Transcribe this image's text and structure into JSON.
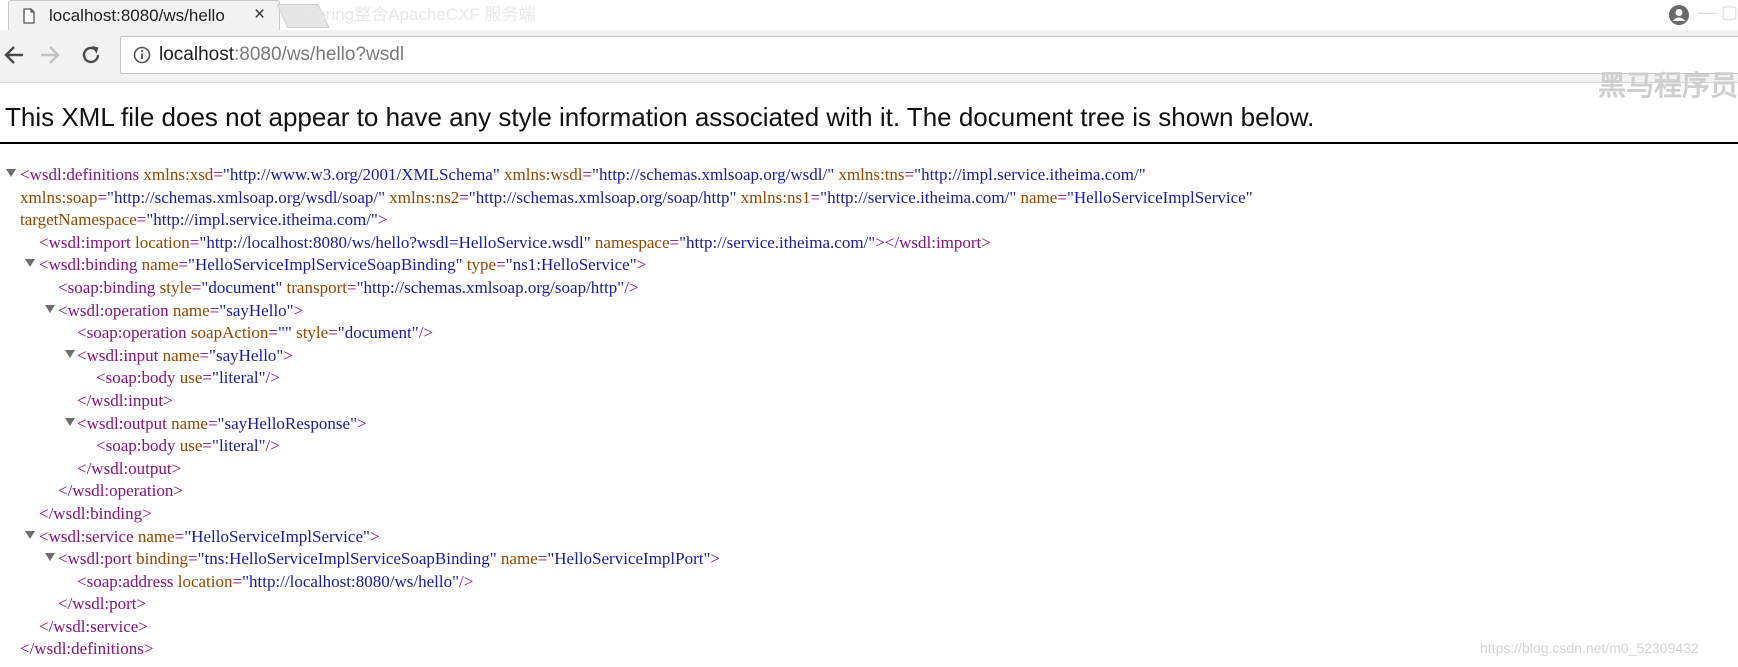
{
  "browser": {
    "tab_title": "localhost:8080/ws/hello",
    "tab_close": "×",
    "overlay_title": "Spring整合ApacheCXF 服务端",
    "url_host": "localhost",
    "url_rest": ":8080/ws/hello?wsdl",
    "brand_watermark": "黑马程序员",
    "icons": [
      "document-icon",
      "close-icon",
      "account-icon",
      "back-icon",
      "forward-icon",
      "reload-icon",
      "info-icon"
    ]
  },
  "page": {
    "notice": "This XML file does not appear to have any style information associated with it. The document tree is shown below.",
    "footer_watermark": "https://blog.csdn.net/m0_52309432"
  },
  "tree": {
    "lines": [
      {
        "lead": "<wsdl:definitions",
        "attrs": [
          [
            "xmlns:xsd",
            "http://www.w3.org/2001/XMLSchema"
          ],
          [
            "xmlns:wsdl",
            "http://schemas.xmlsoap.org/wsdl/"
          ],
          [
            "xmlns:tns",
            "http://impl.service.itheima.com/"
          ]
        ],
        "trail": ""
      },
      {
        "lead": "",
        "attrs": [
          [
            "xmlns:soap",
            "http://schemas.xmlsoap.org/wsdl/soap/"
          ],
          [
            "xmlns:ns2",
            "http://schemas.xmlsoap.org/soap/http"
          ],
          [
            "xmlns:ns1",
            "http://service.itheima.com/"
          ],
          [
            "name",
            "HelloServiceImplService"
          ]
        ],
        "trail": ""
      },
      {
        "lead": "",
        "attrs": [
          [
            "targetNamespace",
            "http://impl.service.itheima.com/"
          ]
        ],
        "trail": ">"
      },
      {
        "lead": "<wsdl:import",
        "attrs": [
          [
            "location",
            "http://localhost:8080/ws/hello?wsdl=HelloService.wsdl"
          ],
          [
            "namespace",
            "http://service.itheima.com/"
          ]
        ],
        "trail": "></wsdl:import>"
      },
      {
        "lead": "<wsdl:binding",
        "attrs": [
          [
            "name",
            "HelloServiceImplServiceSoapBinding"
          ],
          [
            "type",
            "ns1:HelloService"
          ]
        ],
        "trail": ">"
      },
      {
        "lead": "<soap:binding",
        "attrs": [
          [
            "style",
            "document"
          ],
          [
            "transport",
            "http://schemas.xmlsoap.org/soap/http"
          ]
        ],
        "trail": "/>"
      },
      {
        "lead": "<wsdl:operation",
        "attrs": [
          [
            "name",
            "sayHello"
          ]
        ],
        "trail": ">"
      },
      {
        "lead": "<soap:operation",
        "attrs": [
          [
            "soapAction",
            ""
          ],
          [
            "style",
            "document"
          ]
        ],
        "trail": "/>"
      },
      {
        "lead": "<wsdl:input",
        "attrs": [
          [
            "name",
            "sayHello"
          ]
        ],
        "trail": ">"
      },
      {
        "lead": "<soap:body",
        "attrs": [
          [
            "use",
            "literal"
          ]
        ],
        "trail": "/>"
      },
      {
        "lead": "</wsdl:input>",
        "attrs": [],
        "trail": ""
      },
      {
        "lead": "<wsdl:output",
        "attrs": [
          [
            "name",
            "sayHelloResponse"
          ]
        ],
        "trail": ">"
      },
      {
        "lead": "<soap:body",
        "attrs": [
          [
            "use",
            "literal"
          ]
        ],
        "trail": "/>"
      },
      {
        "lead": "</wsdl:output>",
        "attrs": [],
        "trail": ""
      },
      {
        "lead": "</wsdl:operation>",
        "attrs": [],
        "trail": ""
      },
      {
        "lead": "</wsdl:binding>",
        "attrs": [],
        "trail": ""
      },
      {
        "lead": "<wsdl:service",
        "attrs": [
          [
            "name",
            "HelloServiceImplService"
          ]
        ],
        "trail": ">"
      },
      {
        "lead": "<wsdl:port",
        "attrs": [
          [
            "binding",
            "tns:HelloServiceImplServiceSoapBinding"
          ],
          [
            "name",
            "HelloServiceImplPort"
          ]
        ],
        "trail": ">"
      },
      {
        "lead": "<soap:address",
        "attrs": [
          [
            "location",
            "http://localhost:8080/ws/hello"
          ]
        ],
        "trail": "/>"
      },
      {
        "lead": "</wsdl:port>",
        "attrs": [],
        "trail": ""
      },
      {
        "lead": "</wsdl:service>",
        "attrs": [],
        "trail": ""
      },
      {
        "lead": "</wsdl:definitions>",
        "attrs": [],
        "trail": ""
      }
    ]
  }
}
